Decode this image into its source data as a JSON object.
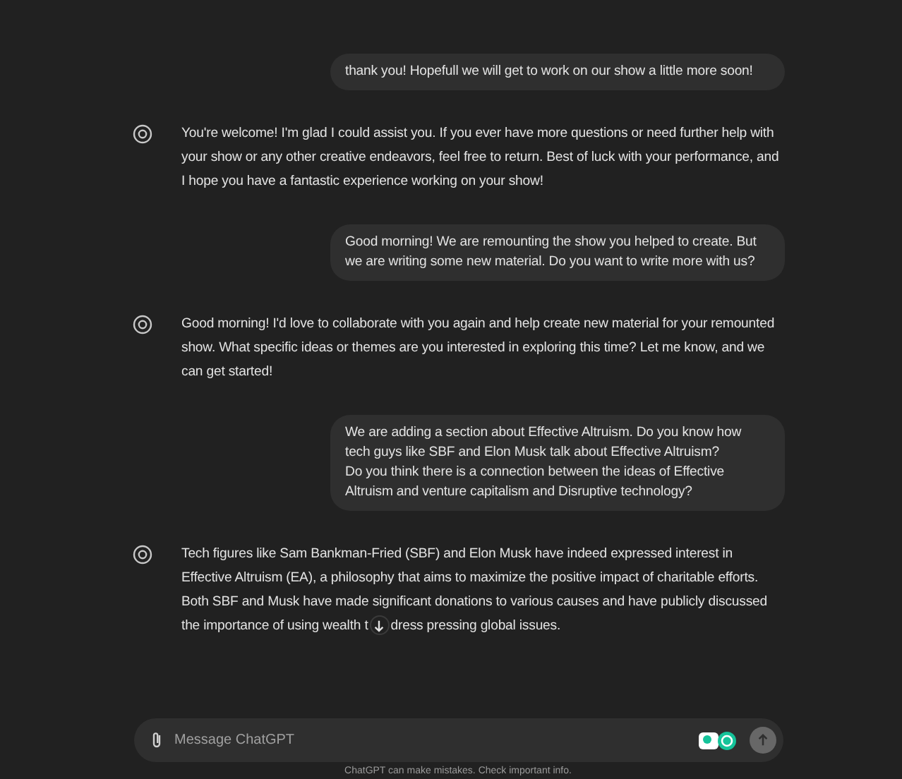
{
  "messages": [
    {
      "kind": "user",
      "text": "thank you! Hopefull we will get to work on our show a little more soon!"
    },
    {
      "kind": "assistant",
      "text": "You're welcome! I'm glad I could assist you. If you ever have more questions or need further help with your show or any other creative endeavors, feel free to return. Best of luck with your performance, and I hope you have a fantastic experience working on your show!"
    },
    {
      "kind": "user",
      "text": "Good morning! We are remounting the show you helped to create. But we are writing some new material. Do you want to write more with us?"
    },
    {
      "kind": "assistant",
      "text": "Good morning! I'd love to collaborate with you again and help create new material for your remounted show. What specific ideas or themes are you interested in exploring this time? Let me know, and we can get started!"
    },
    {
      "kind": "user",
      "text": "We are adding a section about Effective Altruism. Do you know how tech guys like SBF and Elon Musk talk about Effective Altruism?\nDo you think there is a connection between the ideas of Effective Altruism and venture capitalism and Disruptive technology?"
    },
    {
      "kind": "assistant",
      "text": "Tech figures like Sam Bankman-Fried (SBF) and Elon Musk have indeed expressed interest in Effective Altruism (EA), a philosophy that aims to maximize the positive impact of charitable efforts. Both SBF and Musk have made significant donations to various causes and have publicly discussed the importance of using wealth t",
      "text_after": "dress pressing global issues."
    }
  ],
  "composer": {
    "placeholder": "Message ChatGPT"
  },
  "footer": "ChatGPT can make mistakes. Check important info."
}
